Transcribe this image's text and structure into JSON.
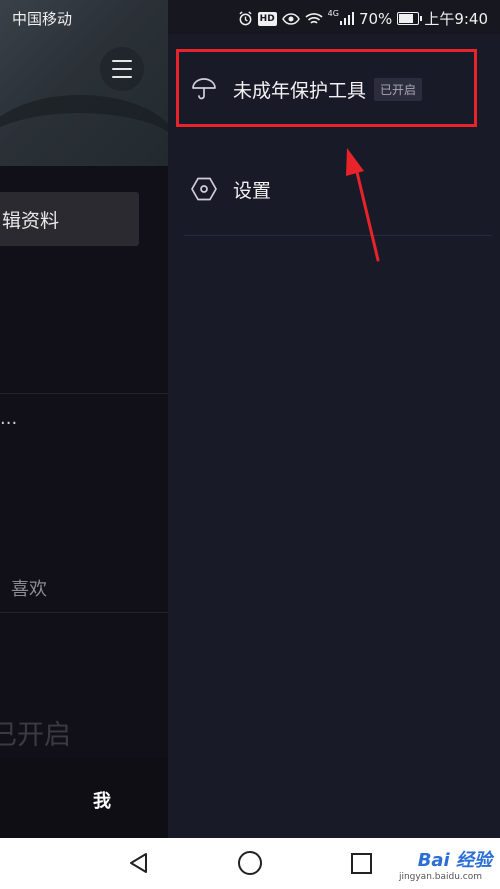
{
  "status_bar": {
    "carrier": "中国移动",
    "icons": [
      "alarm-icon",
      "hd-icon",
      "eye-icon",
      "wifi-icon",
      "signal-icon"
    ],
    "hd": "HD",
    "network": "4G",
    "battery": "70%",
    "time": "上午9:40"
  },
  "background_app": {
    "edit_profile": "辑资料",
    "ellipsis": "...",
    "likes": "喜欢",
    "open_status": "已开启",
    "tab_me": "我"
  },
  "drawer": {
    "items": [
      {
        "icon": "umbrella-icon",
        "label": "未成年保护工具",
        "badge": "已开启"
      },
      {
        "icon": "hexagon-settings-icon",
        "label": "设置"
      }
    ]
  },
  "watermark": {
    "brand": "Bai 经验",
    "url": "jingyan.baidu.com"
  },
  "colors": {
    "highlight": "#e8232a",
    "drawer_bg": "#191a28",
    "arrow": "#e8232a"
  }
}
